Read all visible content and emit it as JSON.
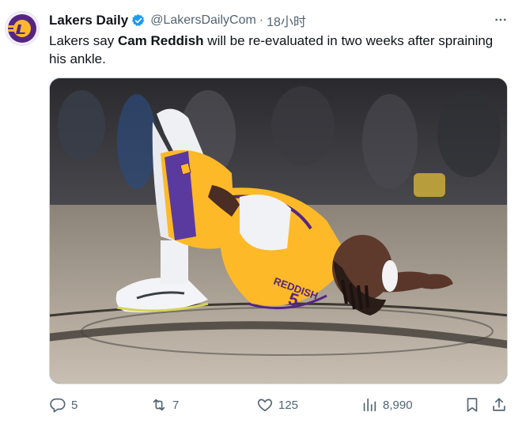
{
  "tweet": {
    "author": {
      "display_name": "Lakers Daily",
      "handle": "@LakersDailyCom",
      "verified_icon": "verified-badge-icon",
      "avatar_icon": "lakers-logo",
      "brand_colors": {
        "purple": "#552583",
        "gold": "#FDB927"
      }
    },
    "separator": "·",
    "timestamp": "18小时",
    "text": {
      "part1": "Lakers say ",
      "bold": "Cam Reddish",
      "part2": " will be re-evaluated in two weeks after spraining his ankle."
    },
    "media": {
      "jersey_lettering": "REDDISH"
    },
    "actions": {
      "replies": "5",
      "retweets": "7",
      "likes": "125",
      "views": "8,990"
    },
    "accent_color": "#1d9bf0"
  }
}
